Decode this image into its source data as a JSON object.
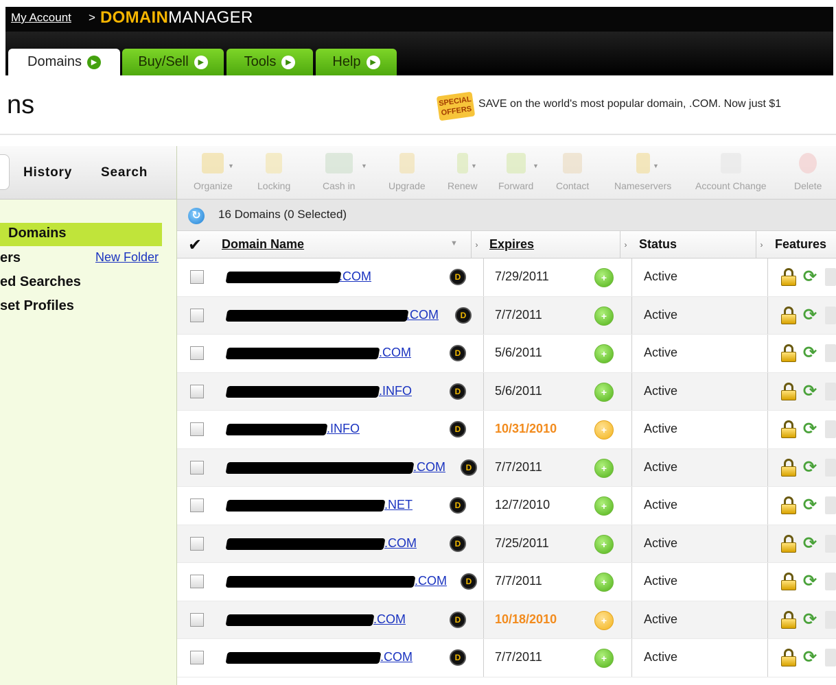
{
  "header": {
    "account_link": "My Account",
    "separator": ">",
    "brand_part1": "DOMAIN",
    "brand_part2": "MANAGER",
    "brand_color": "#f7b600"
  },
  "tabs": [
    {
      "label": "Domains",
      "active": true
    },
    {
      "label": "Buy/Sell",
      "active": false
    },
    {
      "label": "Tools",
      "active": false
    },
    {
      "label": "Help",
      "active": false
    }
  ],
  "page": {
    "title": "ns",
    "promo_badge": "SPECIAL OFFERS",
    "promo_text": "SAVE on the world's most popular domain, .COM. Now just $1"
  },
  "sidebar": {
    "tabs": [
      "History",
      "Search"
    ],
    "selected_item": "Domains",
    "items": [
      "ers",
      "ed Searches",
      "set Profiles"
    ],
    "new_folder": "New Folder",
    "highlight_color": "#c0e43a"
  },
  "toolbar": {
    "buttons": [
      {
        "label": "Organize",
        "icon": "folder-icon"
      },
      {
        "label": "Locking",
        "icon": "lock-icon"
      },
      {
        "label": "Cash in",
        "icon": "cash-in-icon"
      },
      {
        "label": "Upgrade",
        "icon": "upgrade-icon"
      },
      {
        "label": "Renew",
        "icon": "renew-icon"
      },
      {
        "label": "Forward",
        "icon": "forward-icon"
      },
      {
        "label": "Contact",
        "icon": "contact-icon"
      },
      {
        "label": "Nameservers",
        "icon": "nameservers-icon"
      },
      {
        "label": "Account Change",
        "icon": "account-change-icon"
      },
      {
        "label": "Delete",
        "icon": "delete-icon"
      }
    ]
  },
  "list": {
    "count_text": "16 Domains (0 Selected)",
    "columns": {
      "check": "✔",
      "domain": "Domain Name",
      "expires": "Expires",
      "status": "Status",
      "features": "Features"
    },
    "rows": [
      {
        "domain_suffix": ".COM",
        "expires": "7/29/2011",
        "warn": false,
        "status": "Active"
      },
      {
        "domain_suffix": ".COM",
        "expires": "7/7/2011",
        "warn": false,
        "status": "Active"
      },
      {
        "domain_suffix": ".COM",
        "expires": "5/6/2011",
        "warn": false,
        "status": "Active"
      },
      {
        "domain_suffix": ".INFO",
        "expires": "5/6/2011",
        "warn": false,
        "status": "Active"
      },
      {
        "domain_suffix": ".INFO",
        "expires": "10/31/2010",
        "warn": true,
        "status": "Active"
      },
      {
        "domain_suffix": ".COM",
        "expires": "7/7/2011",
        "warn": false,
        "status": "Active"
      },
      {
        "domain_suffix": ".NET",
        "expires": "12/7/2010",
        "warn": false,
        "status": "Active"
      },
      {
        "domain_suffix": ".COM",
        "expires": "7/25/2011",
        "warn": false,
        "status": "Active"
      },
      {
        "domain_suffix": ".COM",
        "expires": "7/7/2011",
        "warn": false,
        "status": "Active"
      },
      {
        "domain_suffix": ".COM",
        "expires": "10/18/2010",
        "warn": true,
        "status": "Active"
      },
      {
        "domain_suffix": ".COM",
        "expires": "7/7/2011",
        "warn": false,
        "status": "Active"
      }
    ],
    "warn_color": "#f28b1d",
    "link_color": "#1a33c0"
  }
}
